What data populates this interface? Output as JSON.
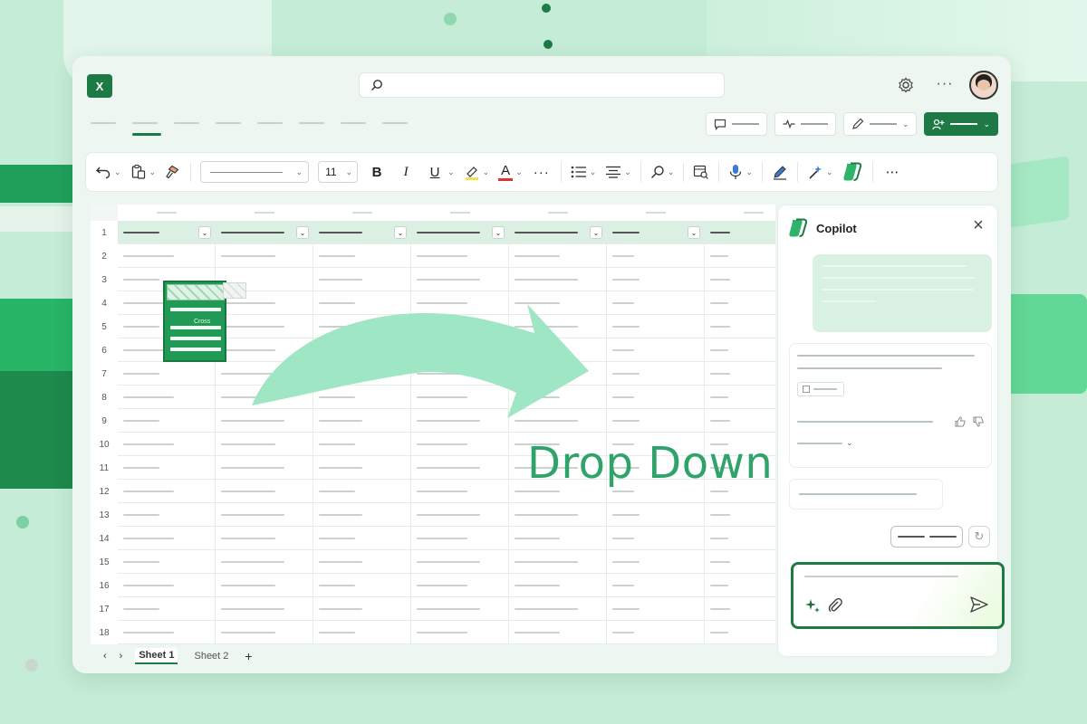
{
  "app": {
    "name": "Excel"
  },
  "toolbar": {
    "font_size": "11",
    "bold_label": "B",
    "italic_label": "I",
    "underline_label": "U",
    "font_color_label": "A",
    "more_label": "···"
  },
  "sheet": {
    "row_numbers": [
      "1",
      "2",
      "3",
      "4",
      "5",
      "6",
      "7",
      "8",
      "9",
      "10",
      "11",
      "12",
      "13",
      "14",
      "15",
      "16",
      "17",
      "18"
    ],
    "tabs": [
      {
        "label": "Sheet 1",
        "active": true
      },
      {
        "label": "Sheet 2",
        "active": false
      }
    ],
    "add_sheet_label": "+",
    "prev_label": "‹",
    "next_label": "›"
  },
  "overlay": {
    "drop_label": "Drop Down",
    "glyph_caption": "Cross",
    "arrow_color": "#9fe6c4",
    "text_color": "#2ea36a"
  },
  "copilot": {
    "title": "Copilot",
    "close_label": "×"
  },
  "colors": {
    "brand": "#1d7a44",
    "accent": "#219a56",
    "header_band": "#dcefe3"
  }
}
